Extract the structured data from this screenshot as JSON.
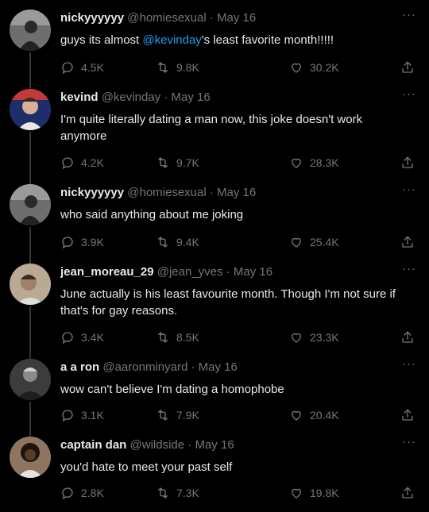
{
  "tweets": [
    {
      "name": "nickyyyyyy",
      "handle": "@homiesexual",
      "date": "May 16",
      "text_before": "guys its almost ",
      "mention": "@kevinday",
      "text_after": "'s least favorite month!!!!!",
      "replies": "4.5K",
      "retweets": "9.8K",
      "likes": "30.2K",
      "avatar_color": "#5a5a5a"
    },
    {
      "name": "kevind",
      "handle": "@kevinday",
      "date": "May 16",
      "text": "I'm quite literally dating a man now, this joke doesn't work anymore",
      "replies": "4.2K",
      "retweets": "9.7K",
      "likes": "28.3K",
      "avatar_color": "#2a3a6a"
    },
    {
      "name": "nickyyyyyy",
      "handle": "@homiesexual",
      "date": "May 16",
      "text": "who said anything about me joking",
      "replies": "3.9K",
      "retweets": "9.4K",
      "likes": "25.4K",
      "avatar_color": "#5a5a5a"
    },
    {
      "name": "jean_moreau_29",
      "handle": "@jean_yves",
      "date": "May 16",
      "text": "June actually is his least favourite month. Though I'm not sure if that's for gay reasons.",
      "replies": "3.4K",
      "retweets": "8.5K",
      "likes": "23.3K",
      "avatar_color": "#8a7a6a"
    },
    {
      "name": "a a ron",
      "handle": "@aaronminyard",
      "date": "May 16",
      "text": "wow can't believe I'm dating a homophobe",
      "replies": "3.1K",
      "retweets": "7.9K",
      "likes": "20.4K",
      "avatar_color": "#4a4a4a"
    },
    {
      "name": "captain dan",
      "handle": "@wildside",
      "date": "May 16",
      "text": "you'd hate to meet your past self",
      "replies": "2.8K",
      "retweets": "7.3K",
      "likes": "19.8K",
      "avatar_color": "#6b5844"
    }
  ],
  "meta_separator": "·",
  "more_glyph": "···"
}
